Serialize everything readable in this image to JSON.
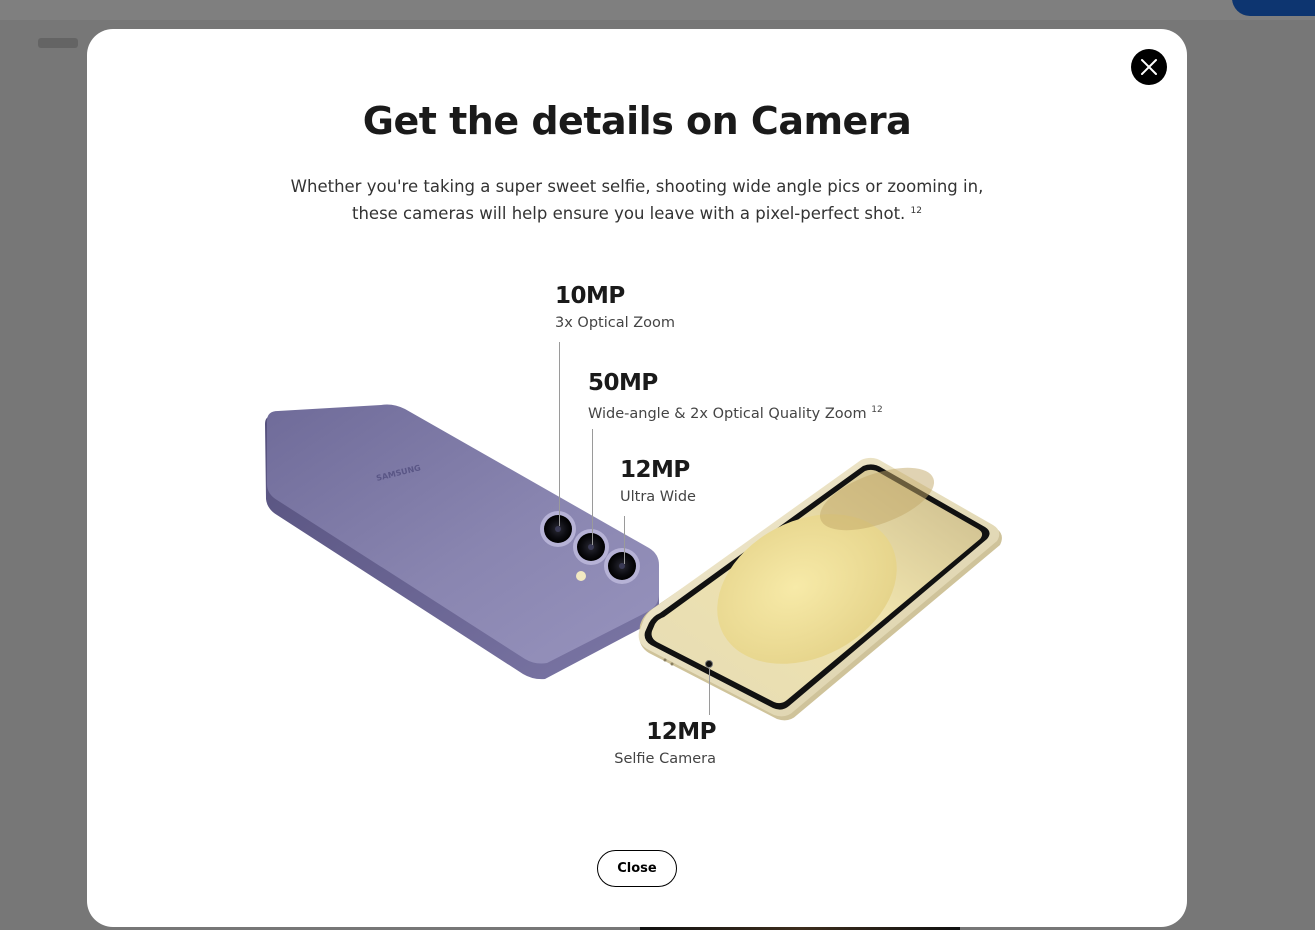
{
  "modal": {
    "title": "Get the details on Camera",
    "description": "Whether you're taking a super sweet selfie, shooting wide angle pics or zooming in, these cameras will help ensure you leave with a pixel-perfect shot.",
    "description_footnote": "12",
    "close_icon": "close-icon",
    "close_label": "Close"
  },
  "cameras": [
    {
      "megapixels": "10MP",
      "label": "3x Optical Zoom",
      "footnote": ""
    },
    {
      "megapixels": "50MP",
      "label": "Wide-angle & 2x Optical Quality Zoom",
      "footnote": "12"
    },
    {
      "megapixels": "12MP",
      "label": "Ultra Wide",
      "footnote": ""
    },
    {
      "megapixels": "12MP",
      "label": "Selfie Camera",
      "footnote": ""
    }
  ],
  "phone_back": {
    "brand_text": "SAMSUNG",
    "color": "#8d89b3"
  },
  "phone_front": {
    "frame_color": "#efe6c8",
    "screen_color": "#e8d9a0"
  },
  "colors": {
    "overlay": "rgba(0,0,0,0.5)",
    "modal_bg": "#ffffff",
    "text_dark": "#1a1a1a",
    "accent": "#1b6be0"
  }
}
